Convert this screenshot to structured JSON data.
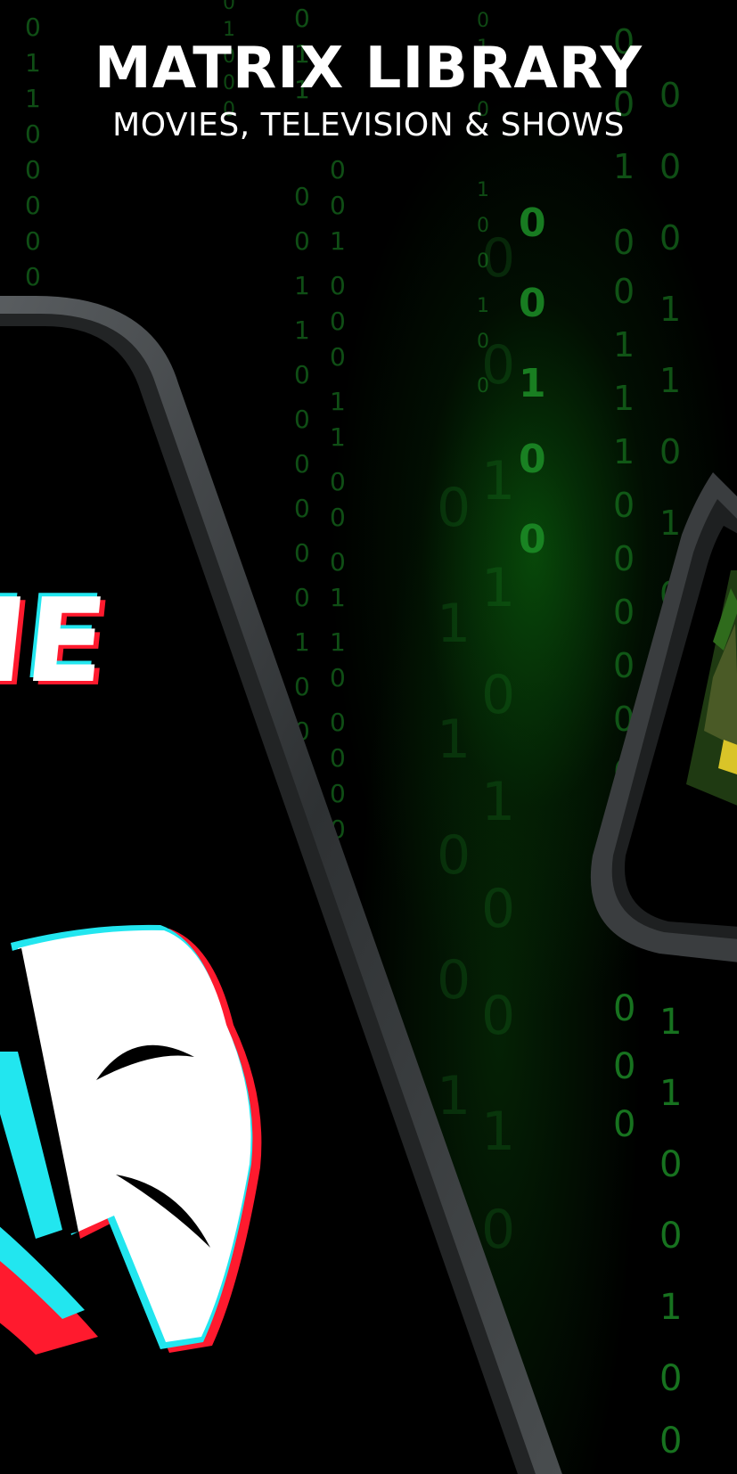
{
  "header": {
    "title": "MATRIX LIBRARY",
    "subtitle": "MOVIES, TELEVISION & SHOWS"
  },
  "phone_left": {
    "screen_text": "ME",
    "icon": "theater-mask-icon"
  },
  "phone_right": {
    "content": "movie-poster-thumbnail"
  },
  "colors": {
    "background": "#000000",
    "code_rain": "#1d8f27",
    "glow": "#10961a",
    "glitch_cyan": "#22e6ef",
    "glitch_red": "#ff1a2e",
    "phone_frame": "#3a3d3f"
  }
}
